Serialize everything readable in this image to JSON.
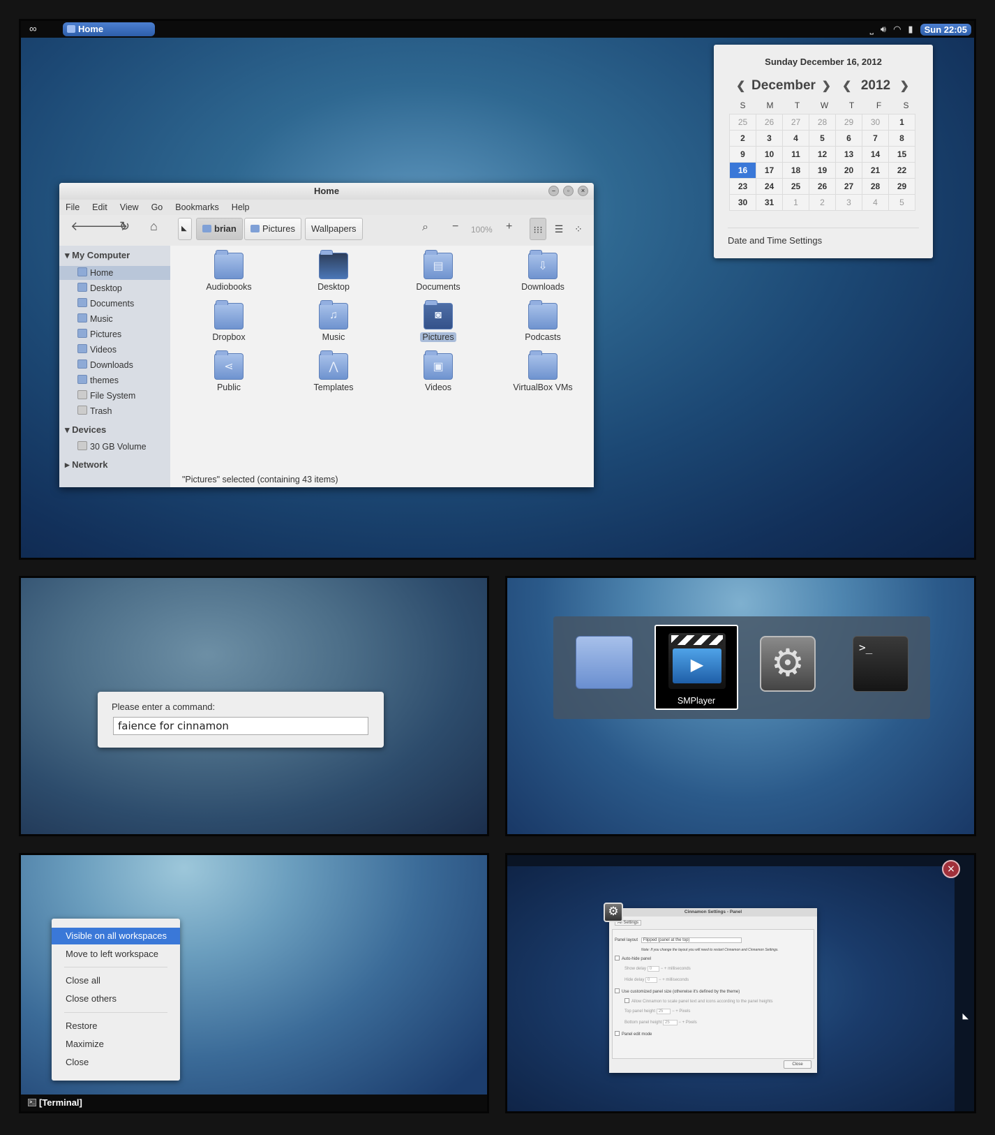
{
  "panel": {
    "window_button": "Home",
    "clock": "Sun 22:05"
  },
  "calendar": {
    "full_date": "Sunday December 16, 2012",
    "month": "December",
    "year": "2012",
    "weekdays": [
      "S",
      "M",
      "T",
      "W",
      "T",
      "F",
      "S"
    ],
    "weeks": [
      [
        "25",
        "26",
        "27",
        "28",
        "29",
        "30",
        "1"
      ],
      [
        "2",
        "3",
        "4",
        "5",
        "6",
        "7",
        "8"
      ],
      [
        "9",
        "10",
        "11",
        "12",
        "13",
        "14",
        "15"
      ],
      [
        "16",
        "17",
        "18",
        "19",
        "20",
        "21",
        "22"
      ],
      [
        "23",
        "24",
        "25",
        "26",
        "27",
        "28",
        "29"
      ],
      [
        "30",
        "31",
        "1",
        "2",
        "3",
        "4",
        "5"
      ]
    ],
    "today": "16",
    "settings_label": "Date and Time Settings"
  },
  "file_manager": {
    "title": "Home",
    "menu": [
      "File",
      "Edit",
      "View",
      "Go",
      "Bookmarks",
      "Help"
    ],
    "path": [
      "brian",
      "Pictures",
      "Wallpapers"
    ],
    "zoom": "100%",
    "sidebar": {
      "my_computer": "My Computer",
      "places": [
        "Home",
        "Desktop",
        "Documents",
        "Music",
        "Pictures",
        "Videos",
        "Downloads",
        "themes",
        "File System",
        "Trash"
      ],
      "devices": "Devices",
      "volumes": [
        "30 GB Volume"
      ],
      "network": "Network"
    },
    "items": [
      "Audiobooks",
      "Desktop",
      "Documents",
      "Downloads",
      "Dropbox",
      "Music",
      "Pictures",
      "Podcasts",
      "Public",
      "Templates",
      "Videos",
      "VirtualBox VMs"
    ],
    "selected_item": "Pictures",
    "status": "\"Pictures\" selected (containing 43 items)"
  },
  "run_dialog": {
    "prompt": "Please enter a command:",
    "value": "faience for cinnamon"
  },
  "alt_tab": {
    "selected_label": "SMPlayer",
    "apps": [
      "folder-icon",
      "smplayer-icon",
      "settings-gear-icon",
      "terminal-icon"
    ]
  },
  "context_menu": {
    "items": [
      "Visible on all workspaces",
      "Move to left workspace",
      "Close all",
      "Close others",
      "Restore",
      "Maximize",
      "Close"
    ]
  },
  "bottom_panel": {
    "window_button": "[Terminal]"
  },
  "cinnamon_settings": {
    "title": "Cinnamon Settings - Panel",
    "all_settings": "All Settings",
    "panel_layout_label": "Panel layout",
    "panel_layout_value": "Flipped (panel at the top)",
    "note": "Note: If you change the layout you will need to restart Cinnamon and Cinnamon Settings.",
    "auto_hide": "Auto-hide panel",
    "show_delay": "Show delay",
    "hide_delay": "Hide delay",
    "delay_value": "0",
    "milliseconds": "milliseconds",
    "custom_size": "Use customized panel size (otherwise it's defined by the theme)",
    "allow_scale": "Allow Cinnamon to scale panel text and icons according to the panel heights",
    "top_height": "Top panel height",
    "bottom_height": "Bottom panel height",
    "height_value": "25",
    "pixels": "Pixels",
    "edit_mode": "Panel edit mode",
    "close": "Close"
  },
  "colors": {
    "accent": "#3a78d8",
    "panel": "#0b0b0b"
  }
}
